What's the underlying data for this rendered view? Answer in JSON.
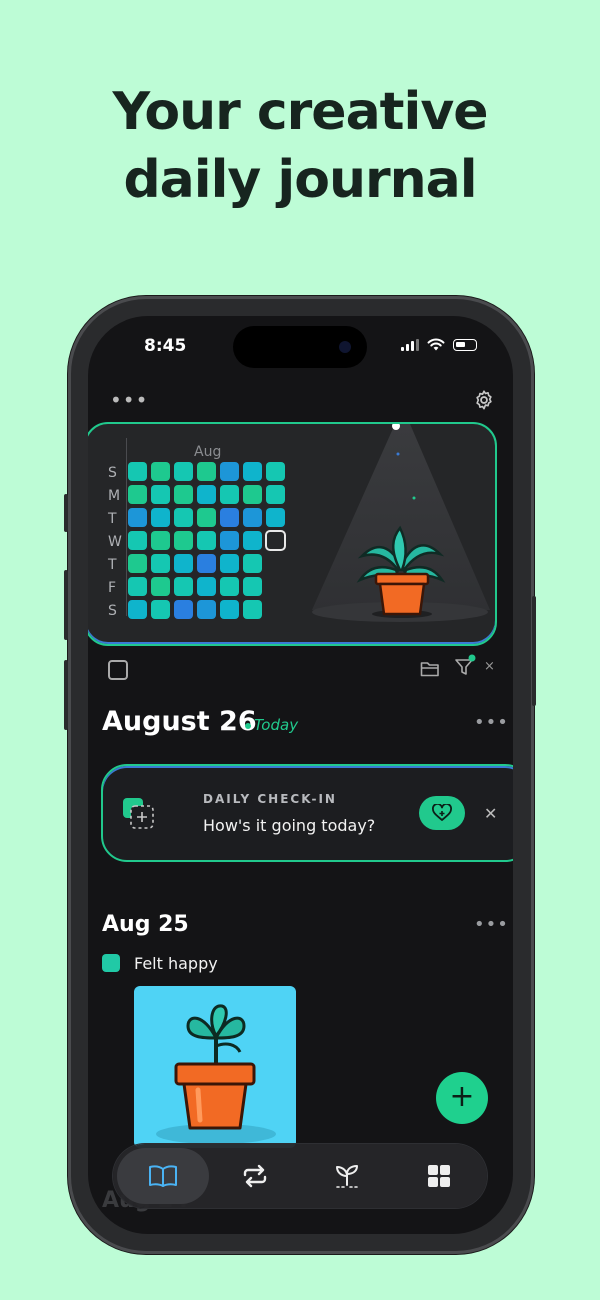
{
  "headline": [
    "Your creative",
    "daily journal"
  ],
  "status_bar": {
    "time": "8:45"
  },
  "calendar": {
    "month": "Aug",
    "day_labels": [
      "S",
      "M",
      "T",
      "W",
      "T",
      "F",
      "S"
    ]
  },
  "journal": {
    "today_date": "August 26",
    "today_tag": "Today",
    "checkin": {
      "title": "DAILY CHECK-IN",
      "question": "How's it going today?"
    },
    "entry_date": "Aug 25",
    "mood_label": "Felt happy",
    "next_date": "Aug 24"
  },
  "tabbar": {
    "items": [
      "journal-icon",
      "repeat-icon",
      "sprout-icon",
      "grid-icon"
    ],
    "active": 0
  },
  "colors": {
    "background": "#bdfcd6",
    "accent": "#21c98d",
    "screen": "#141416"
  }
}
